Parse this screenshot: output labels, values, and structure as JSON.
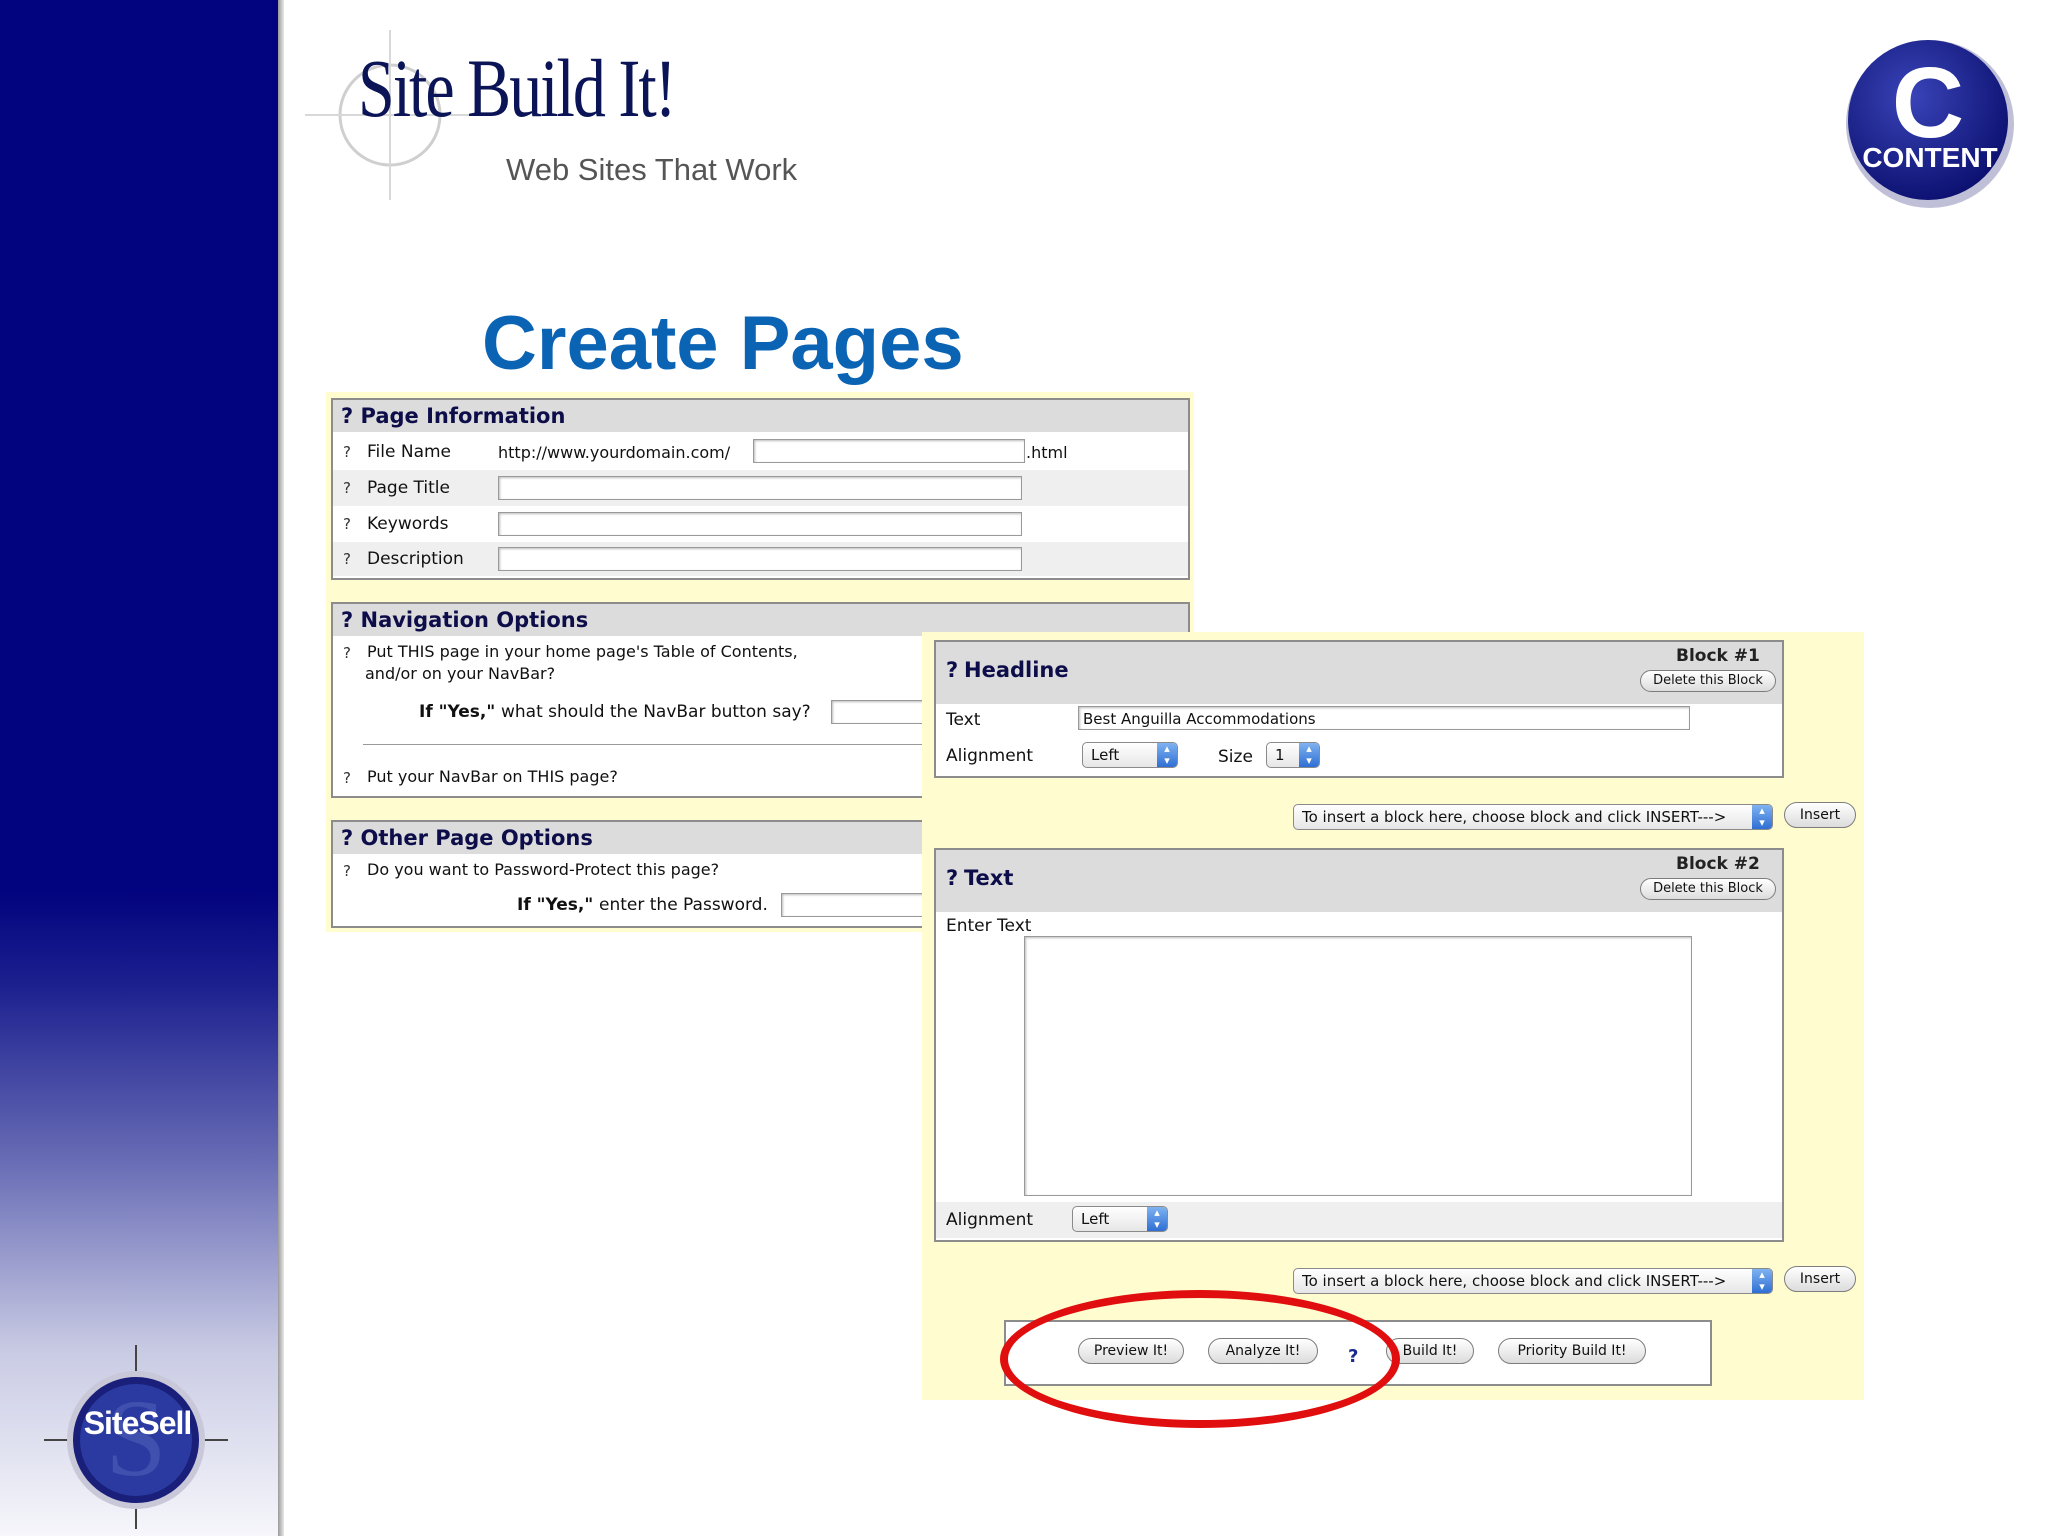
{
  "logo": {
    "title": "Site Build It!",
    "tagline": "Web Sites That Work"
  },
  "badge": {
    "label": "CONTENT"
  },
  "sitesell": {
    "label": "SiteSell"
  },
  "heading": "Create Pages",
  "page_info": {
    "title": "Page Information",
    "help": "?",
    "rows": [
      {
        "label": "File Name",
        "prefix": "http://www.yourdomain.com/",
        "suffix": ".html",
        "value": ""
      },
      {
        "label": "Page Title",
        "value": ""
      },
      {
        "label": "Keywords",
        "value": ""
      },
      {
        "label": "Description",
        "value": ""
      }
    ]
  },
  "nav_options": {
    "title": "Navigation Options",
    "question1_line1": "Put THIS page in your home page's Table of Contents,",
    "question1_line2": "and/or on your NavBar?",
    "if_yes_prefix": "If \"Yes,\"",
    "if_yes_text": "what should the NavBar button say?",
    "question2": "Put your NavBar on THIS page?"
  },
  "other_options": {
    "title": "Other Page Options",
    "question": "Do you want to Password-Protect this page?",
    "if_yes_prefix": "If \"Yes,\"",
    "if_yes_text": "enter the Password."
  },
  "block1": {
    "title": "Headline",
    "block_label": "Block #1",
    "delete_label": "Delete this Block",
    "text_label": "Text",
    "text_value": "Best Anguilla Accommodations",
    "alignment_label": "Alignment",
    "alignment_value": "Left",
    "size_label": "Size",
    "size_value": "1"
  },
  "insert_row": {
    "select_value": "To insert a block here, choose block and click INSERT--->",
    "button_label": "Insert"
  },
  "block2": {
    "title": "Text",
    "block_label": "Block #2",
    "delete_label": "Delete this Block",
    "enter_label": "Enter Text",
    "text_value": "",
    "alignment_label": "Alignment",
    "alignment_value": "Left"
  },
  "actions": {
    "preview": "Preview It!",
    "analyze": "Analyze It!",
    "help": "?",
    "build": "Build It!",
    "priority": "Priority Build It!"
  },
  "colors": {
    "sidebar": "#02037e",
    "heading": "#0b63b4",
    "highlight_oval": "#e00e0e",
    "panel_bg": "#fffccf"
  }
}
